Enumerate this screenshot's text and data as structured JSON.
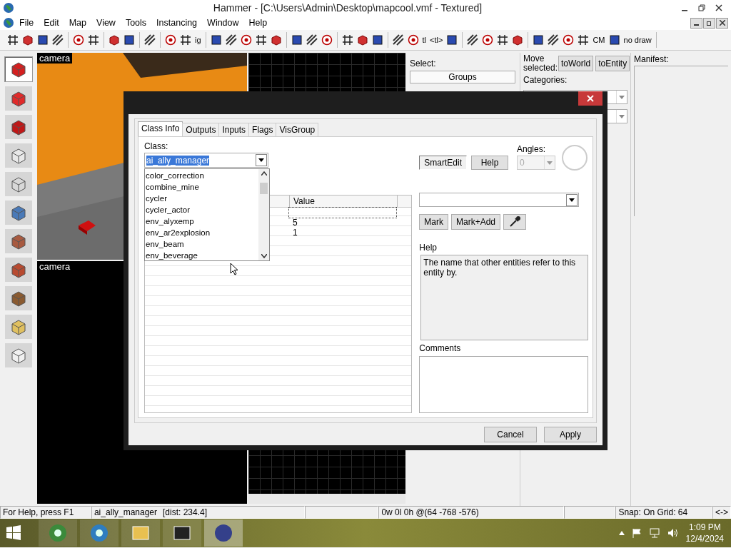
{
  "window": {
    "title": "Hammer - [C:\\Users\\Admin\\Desktop\\mapcool.vmf - Textured]"
  },
  "menu": [
    "File",
    "Edit",
    "Map",
    "View",
    "Tools",
    "Instancing",
    "Window",
    "Help"
  ],
  "toolbar": [
    [
      {
        "kind": "icon"
      },
      {
        "kind": "icon"
      },
      {
        "kind": "icon"
      },
      {
        "kind": "icon"
      }
    ],
    [
      {
        "kind": "icon"
      },
      {
        "kind": "icon"
      }
    ],
    [
      {
        "kind": "icon"
      },
      {
        "kind": "icon"
      }
    ],
    [
      {
        "kind": "icon"
      }
    ],
    [
      {
        "kind": "icon"
      },
      {
        "kind": "icon"
      },
      {
        "kind": "text",
        "label": "ig"
      }
    ],
    [
      {
        "kind": "icon"
      },
      {
        "kind": "icon"
      },
      {
        "kind": "icon"
      },
      {
        "kind": "icon"
      },
      {
        "kind": "icon"
      }
    ],
    [
      {
        "kind": "icon"
      },
      {
        "kind": "icon"
      },
      {
        "kind": "icon"
      }
    ],
    [
      {
        "kind": "icon"
      },
      {
        "kind": "icon"
      },
      {
        "kind": "icon"
      }
    ],
    [
      {
        "kind": "icon"
      },
      {
        "kind": "icon"
      },
      {
        "kind": "text",
        "label": "tl"
      },
      {
        "kind": "text",
        "label": "<tl>"
      },
      {
        "kind": "icon"
      }
    ],
    [
      {
        "kind": "icon"
      },
      {
        "kind": "icon"
      },
      {
        "kind": "icon"
      },
      {
        "kind": "icon"
      }
    ],
    [
      {
        "kind": "icon"
      },
      {
        "kind": "icon"
      },
      {
        "kind": "icon"
      },
      {
        "kind": "icon"
      },
      {
        "kind": "text",
        "label": "CM"
      },
      {
        "kind": "icon"
      },
      {
        "kind": "text",
        "label": "no draw"
      }
    ]
  ],
  "tools": [
    {
      "selected": true
    },
    {
      "selected": false
    },
    {
      "selected": false
    },
    {
      "selected": false
    },
    {
      "selected": false
    },
    {
      "selected": false
    },
    {
      "selected": false
    },
    {
      "selected": false
    },
    {
      "selected": false
    },
    {
      "selected": false
    },
    {
      "selected": false
    }
  ],
  "viewports": [
    {
      "label": "camera"
    },
    {
      "label": "camera"
    }
  ],
  "select_panel": {
    "label": "Select:",
    "button": "Groups"
  },
  "move_panel": {
    "label": "Move selected:",
    "buttons": [
      "toWorld",
      "toEntity"
    ],
    "categories_label": "Categories:"
  },
  "manifest": {
    "label": "Manifest:"
  },
  "dialog": {
    "tabs": [
      {
        "label": "Class Info",
        "selected": true
      },
      {
        "label": "Outputs",
        "selected": false
      },
      {
        "label": "Inputs",
        "selected": false
      },
      {
        "label": "Flags",
        "selected": false
      },
      {
        "label": "VisGroup",
        "selected": false
      }
    ],
    "class_label": "Class:",
    "class_value": "ai_ally_manager",
    "class_list": [
      "color_correction",
      "combine_mine",
      "cycler",
      "cycler_actor",
      "env_alyxemp",
      "env_ar2explosion",
      "env_beam",
      "env_beverage"
    ],
    "table": {
      "columns": [
        "Value"
      ],
      "rows": [
        {
          "value": "",
          "selected": true
        },
        {
          "value": "5",
          "selected": false
        },
        {
          "value": "1",
          "selected": false
        }
      ]
    },
    "smartedit": {
      "label": "SmartEdit",
      "on": true
    },
    "help_button": "Help",
    "angles": {
      "label": "Angles:",
      "value": "0",
      "disabled": true
    },
    "mark_buttons": [
      "Mark",
      "Mark+Add"
    ],
    "help_label": "Help",
    "help_text": "The name that other entities refer to this entity by.",
    "comments_label": "Comments",
    "buttons": [
      "Cancel",
      "Apply"
    ]
  },
  "status_bar": {
    "help": "For Help, press F1",
    "selection": "ai_ally_manager",
    "distance": "[dist: 234.4]",
    "position": "0w 0l 0h @(64 -768 -576)",
    "snap": "Snap: On Grid: 64",
    "last_pane": "<->"
  },
  "taskbar": {
    "apps": [
      {
        "active": false
      },
      {
        "active": false
      },
      {
        "active": false
      },
      {
        "active": false
      },
      {
        "active": true
      }
    ],
    "time": "1:09 PM",
    "date": "12/4/2024"
  }
}
